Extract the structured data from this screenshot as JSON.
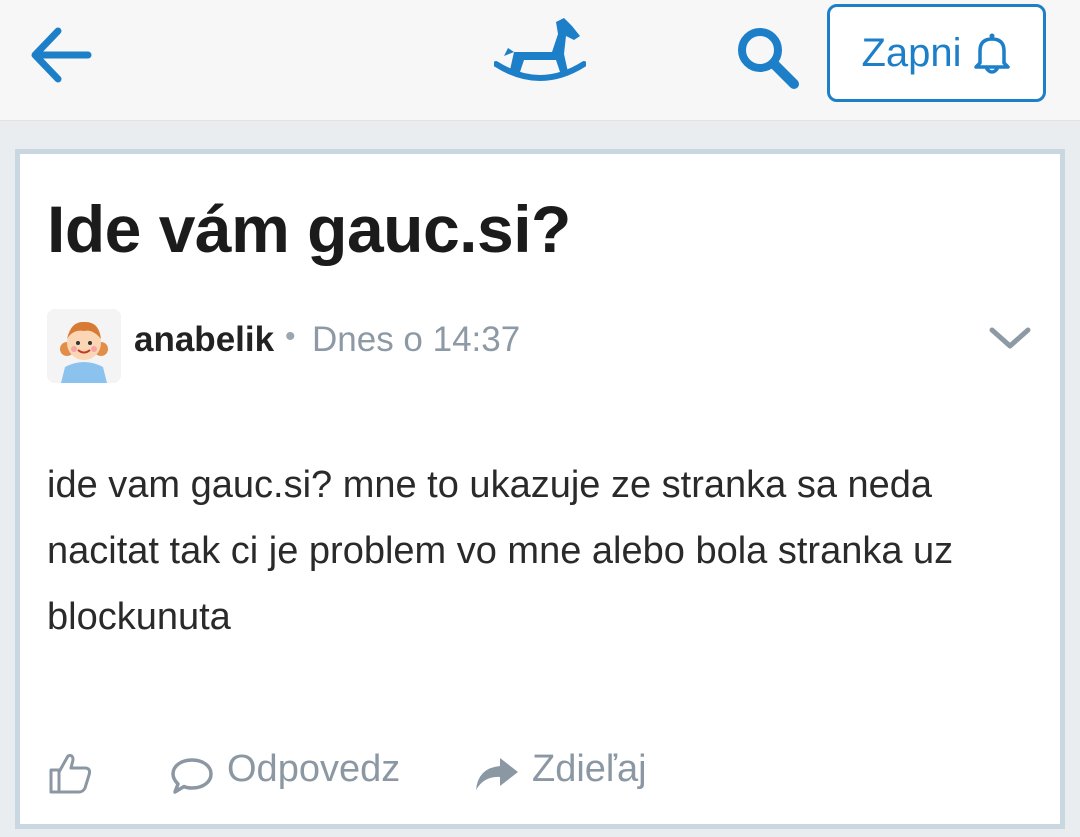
{
  "header": {
    "back_icon": "arrow-left-icon",
    "logo_icon": "rocking-horse-icon",
    "search_icon": "search-icon",
    "subscribe_label": "Zapni",
    "subscribe_icon": "bell-icon"
  },
  "post": {
    "title": "Ide vám gauc.si?",
    "author": "anabelik",
    "separator": "•",
    "timestamp": "Dnes o 14:37",
    "menu_icon": "chevron-down-icon",
    "body": "ide vam gauc.si? mne to ukazuje ze stranka sa neda nacitat tak ci je problem vo mne alebo bola stranka uz blockunuta"
  },
  "actions": {
    "like_icon": "thumbs-up-icon",
    "reply_label": "Odpovedz",
    "reply_icon": "speech-bubble-icon",
    "share_label": "Zdieľaj",
    "share_icon": "share-arrow-icon"
  },
  "colors": {
    "accent": "#1e7fc9",
    "muted": "#8b98a3",
    "card_border": "#c9d7e1"
  }
}
